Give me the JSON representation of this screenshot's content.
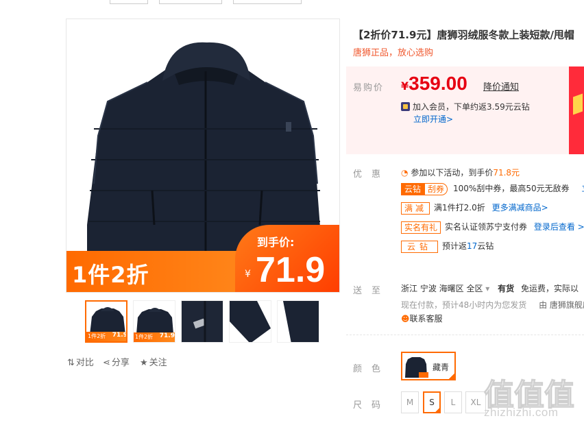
{
  "product": {
    "title": "【2折价71.9元】唐狮羽绒服冬款上装短款/甩帽",
    "subtitle": "唐狮正品，放心选购"
  },
  "image_promo": {
    "left_text": "1件2折",
    "right_label": "到手价:",
    "yen": "¥",
    "price": "71.9"
  },
  "thumbnails": [
    {
      "tag_left": "1件2折",
      "tag_right": "71.9",
      "active": true
    },
    {
      "tag_left": "1件2折",
      "tag_right": "71.9",
      "active": false
    },
    {
      "active": false
    },
    {
      "active": false
    },
    {
      "active": false
    }
  ],
  "actions": {
    "compare": "对比",
    "share": "分享",
    "follow": "关注"
  },
  "price": {
    "label": "易购价",
    "currency": "¥",
    "value": "359.00",
    "notice_link": "降价通知",
    "member_text": "加入会员，下单约返3.59元云钻",
    "member_link": "立即开通>"
  },
  "promo": {
    "label": "优惠",
    "intro_prefix": "参加以下活动，到手价",
    "intro_price": "71.8元",
    "coupon_badge_a": "云钻",
    "coupon_badge_b": "刮券",
    "coupon_text": "100%刮中券，最高50元无敌券",
    "coupon_link": "立",
    "manjian_badge": "满减",
    "manjian_text": "满1件打2.0折",
    "manjian_link": "更多满减商品>",
    "shiming_badge": "实名有礼",
    "shiming_text": "实名认证领苏宁支付券",
    "shiming_link": "登录后查看 >",
    "yunzuan_badge": "云钻",
    "yunzuan_prefix": "预计返",
    "yunzuan_num": "17",
    "yunzuan_suffix": "云钻"
  },
  "delivery": {
    "label": "送至",
    "location": "浙江  宁波  海曙区  全区",
    "stock": "有货",
    "shipping": "免运费，实际以",
    "eta": "现在付款，预计48小时内为您发货",
    "seller": "由 唐狮旗舰店",
    "service": "联系客服"
  },
  "color": {
    "label": "颜色",
    "option": "藏青"
  },
  "size": {
    "label": "尺码",
    "options": [
      "M",
      "S",
      "L",
      "XL"
    ],
    "selected": "S"
  },
  "watermark": {
    "logo": "值值值",
    "site": "zhizhizhi.com"
  },
  "colors": {
    "accent": "#ff6a00",
    "price_red": "#e60012",
    "link_blue": "#0066cc",
    "jacket": "#1b2333"
  }
}
